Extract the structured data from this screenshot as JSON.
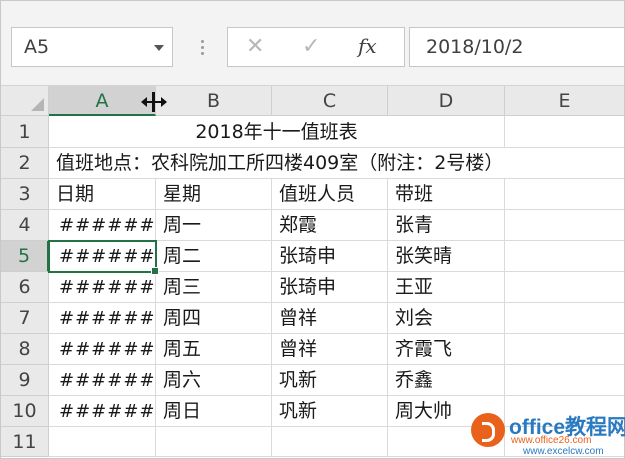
{
  "formula_bar": {
    "name_box": "A5",
    "cancel_symbol": "✕",
    "enter_symbol": "✓",
    "fx_label": "fx",
    "value": "2018/10/2"
  },
  "columns": [
    "A",
    "B",
    "C",
    "D",
    "E"
  ],
  "rows": [
    "1",
    "2",
    "3",
    "4",
    "5",
    "6",
    "7",
    "8",
    "9",
    "10",
    "11"
  ],
  "sheet": {
    "title": "2018年十一值班表",
    "location": "值班地点：农科院加工所四楼409室（附注：2号楼）",
    "headers": [
      "日期",
      "星期",
      "值班人员",
      "带班"
    ],
    "data": [
      [
        "######",
        "周一",
        "郑霞",
        "张青"
      ],
      [
        "######",
        "周二",
        "张琦申",
        "张笑晴"
      ],
      [
        "######",
        "周三",
        "张琦申",
        "王亚"
      ],
      [
        "######",
        "周四",
        "曾祥",
        "刘会"
      ],
      [
        "######",
        "周五",
        "曾祥",
        "齐霞飞"
      ],
      [
        "######",
        "周六",
        "巩新",
        "乔鑫"
      ],
      [
        "######",
        "周日",
        "巩新",
        "周大帅"
      ]
    ]
  },
  "selected_cell": "A5",
  "colors": {
    "accent": "#217346"
  },
  "watermark": {
    "brand": "office教程网",
    "url1": "www.office26.com",
    "url2": "www.excelcw.com"
  }
}
